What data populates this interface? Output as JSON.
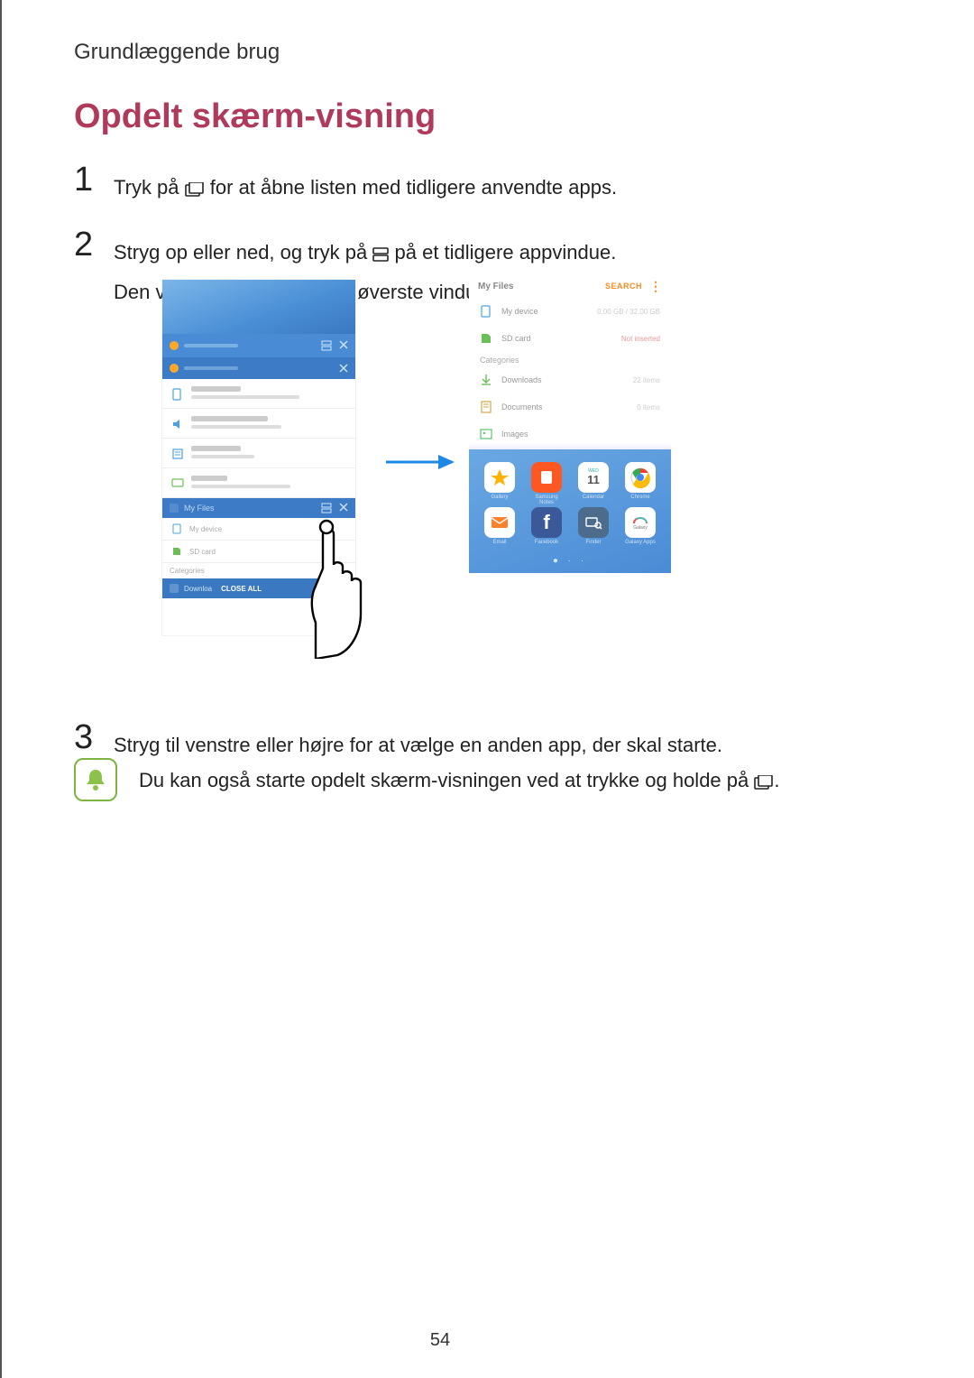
{
  "breadcrumb": "Grundlæggende brug",
  "title": "Opdelt skærm-visning",
  "steps": {
    "s1": {
      "num": "1",
      "before": "Tryk på ",
      "after": " for at åbne listen med tidligere anvendte apps."
    },
    "s2": {
      "num": "2",
      "line1_before": "Stryg op eller ned, og tryk på ",
      "line1_after": " på et tidligere appvindue.",
      "line2": "Den valgte app starter i det øverste vindue."
    },
    "s3": {
      "num": "3",
      "text": "Stryg til venstre eller højre for at vælge en anden app, der skal starte."
    }
  },
  "tip": {
    "before": "Du kan også starte opdelt skærm-visningen ved at trykke og holde på ",
    "after": "."
  },
  "left_phone": {
    "myfiles_label": "My Files",
    "my_device": "My device",
    "sd_card": "SD card",
    "categories": "Categories",
    "downloa": "Downloa",
    "close_all": "CLOSE ALL"
  },
  "right_phone": {
    "title": "My Files",
    "search": "SEARCH",
    "my_device": "My device",
    "my_device_right": "0.00 GB / 32.00 GB",
    "sd_card": "SD card",
    "sd_right": "Not inserted",
    "categories": "Categories",
    "downloads": "Downloads",
    "downloads_right": "22 items",
    "documents": "Documents",
    "documents_right": "0 items",
    "images": "Images",
    "apps": {
      "r1": [
        "Gallery",
        "Samsung Notes",
        "Calendar",
        "Chrome"
      ],
      "r2": [
        "Email",
        "Facebook",
        "Finder",
        "Galaxy Apps"
      ]
    },
    "calendar_day": "11",
    "calendar_top": "WED",
    "galaxy_label": "Galaxy"
  },
  "page_number": "54"
}
